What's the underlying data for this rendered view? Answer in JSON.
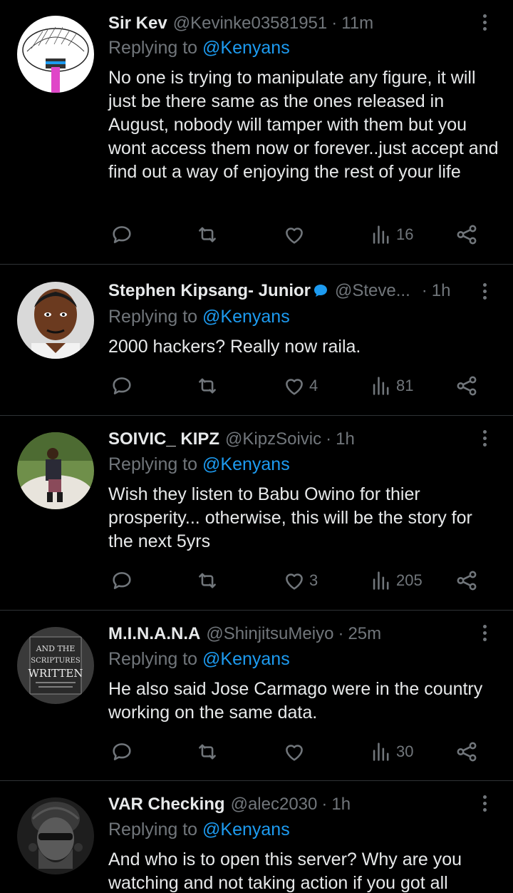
{
  "tweets": [
    {
      "name": "Sir Kev",
      "handle": "@Kevinke03581951",
      "time": "11m",
      "replying_prefix": "Replying to",
      "replying_to": "@Kenyans",
      "text": "No one is trying to manipulate any figure, it will just be there same as the ones released in August, nobody will tamper with them but you wont access them now or forever..just accept and find out a way of enjoying the rest of your life",
      "views": "16"
    },
    {
      "name": "Stephen Kipsang- Junior",
      "handle": "@Steve...",
      "time": "1h",
      "replying_prefix": "Replying to",
      "replying_to": "@Kenyans",
      "text": "2000 hackers? Really now raila.",
      "likes": "4",
      "views": "81"
    },
    {
      "name": "SOIVIC_ KIPZ",
      "handle": "@KipzSoivic",
      "time": "1h",
      "replying_prefix": "Replying to",
      "replying_to": "@Kenyans",
      "text": "Wish they listen to Babu Owino for thier prosperity... otherwise, this will be the story for the next 5yrs",
      "likes": "3",
      "views": "205"
    },
    {
      "name": "M.I.N.A.N.A",
      "handle": "@ShinjitsuMeiyo",
      "time": "25m",
      "replying_prefix": "Replying to",
      "replying_to": "@Kenyans",
      "text": "He also said Jose Carmago were in the country working on the same data.",
      "views": "30",
      "avatar_text": [
        "AND THE",
        "SCRIPTURES",
        "WRITTEN"
      ]
    },
    {
      "name": "VAR Checking",
      "handle": "@alec2030",
      "time": "1h",
      "replying_prefix": "Replying to",
      "replying_to": "@Kenyans",
      "text": "And who is to open this server? Why are you watching and not taking action if you got all"
    }
  ],
  "colors": {
    "background": "#000000",
    "text": "#e7e9ea",
    "muted": "#71767b",
    "link": "#1d9bf0",
    "divider": "#2f3336"
  }
}
